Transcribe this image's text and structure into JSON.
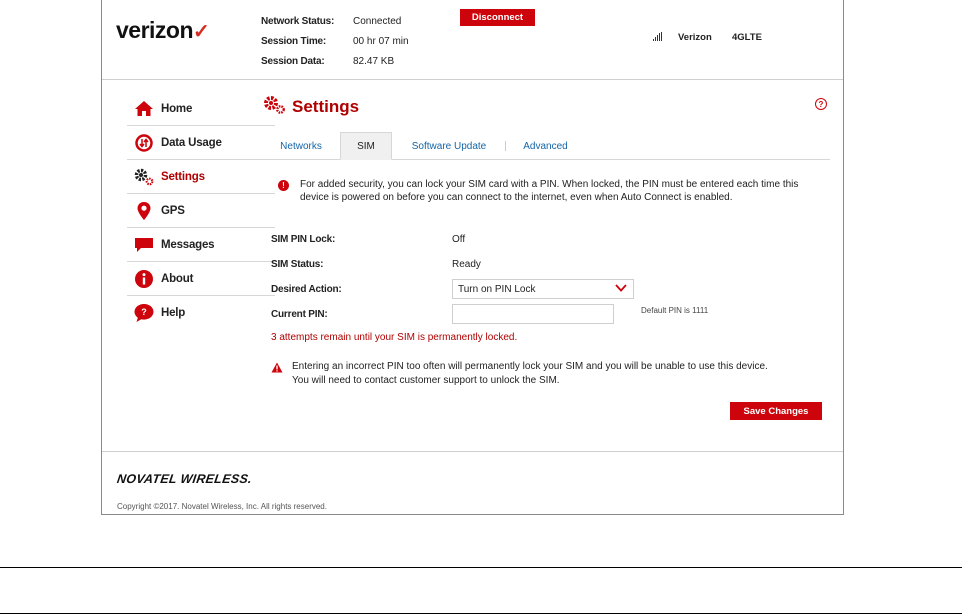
{
  "header": {
    "brand": "verizon",
    "brand_mark": "✓",
    "network_status_label": "Network Status:",
    "network_status_value": "Connected",
    "session_time_label": "Session Time:",
    "session_time_value": "00 hr 07 min",
    "session_data_label": "Session Data:",
    "session_data_value": "82.47 KB",
    "disconnect_label": "Disconnect",
    "carrier": "Verizon",
    "network_type": "4GLTE",
    "signal_icon": "signal-bars-icon"
  },
  "sidebar": {
    "items": [
      {
        "label": "Home",
        "icon": "home-icon"
      },
      {
        "label": "Data Usage",
        "icon": "data-usage-icon"
      },
      {
        "label": "Settings",
        "icon": "gears-icon",
        "active": true
      },
      {
        "label": "GPS",
        "icon": "map-pin-icon"
      },
      {
        "label": "Messages",
        "icon": "message-icon"
      },
      {
        "label": "About",
        "icon": "info-icon"
      },
      {
        "label": "Help",
        "icon": "help-bubble-icon"
      }
    ]
  },
  "main": {
    "title": "Settings",
    "help_glyph": "?",
    "tabs": [
      {
        "label": "Networks"
      },
      {
        "label": "SIM",
        "active": true
      },
      {
        "label": "Software Update"
      },
      {
        "label": "Advanced"
      }
    ],
    "info_glyph": "!",
    "info_text": "For added security, you can lock your SIM card with a PIN. When locked, the PIN must be entered each time this device is powered on before you can connect to the internet, even when Auto Connect is enabled.",
    "sim_pin_lock_label": "SIM PIN Lock:",
    "sim_pin_lock_value": "Off",
    "sim_status_label": "SIM Status:",
    "sim_status_value": "Ready",
    "desired_action_label": "Desired Action:",
    "desired_action_value": "Turn on PIN Lock",
    "current_pin_label": "Current PIN:",
    "current_pin_value": "",
    "default_pin_note": "Default PIN is 1111",
    "attempts_text": "3 attempts remain until your SIM is permanently locked.",
    "warning_text_1": "Entering an incorrect PIN too often will permanently lock your SIM and you will be unable to use this device.",
    "warning_text_2": "You will need to contact customer support to unlock the SIM.",
    "save_label": "Save Changes"
  },
  "footer": {
    "brand": "NOVATEL WIRELESS.",
    "copyright": "Copyright ©2017. Novatel Wireless, Inc. All rights reserved."
  },
  "colors": {
    "accent_red": "#cd040b",
    "title_red": "#b00000",
    "link_blue": "#1565a8"
  }
}
